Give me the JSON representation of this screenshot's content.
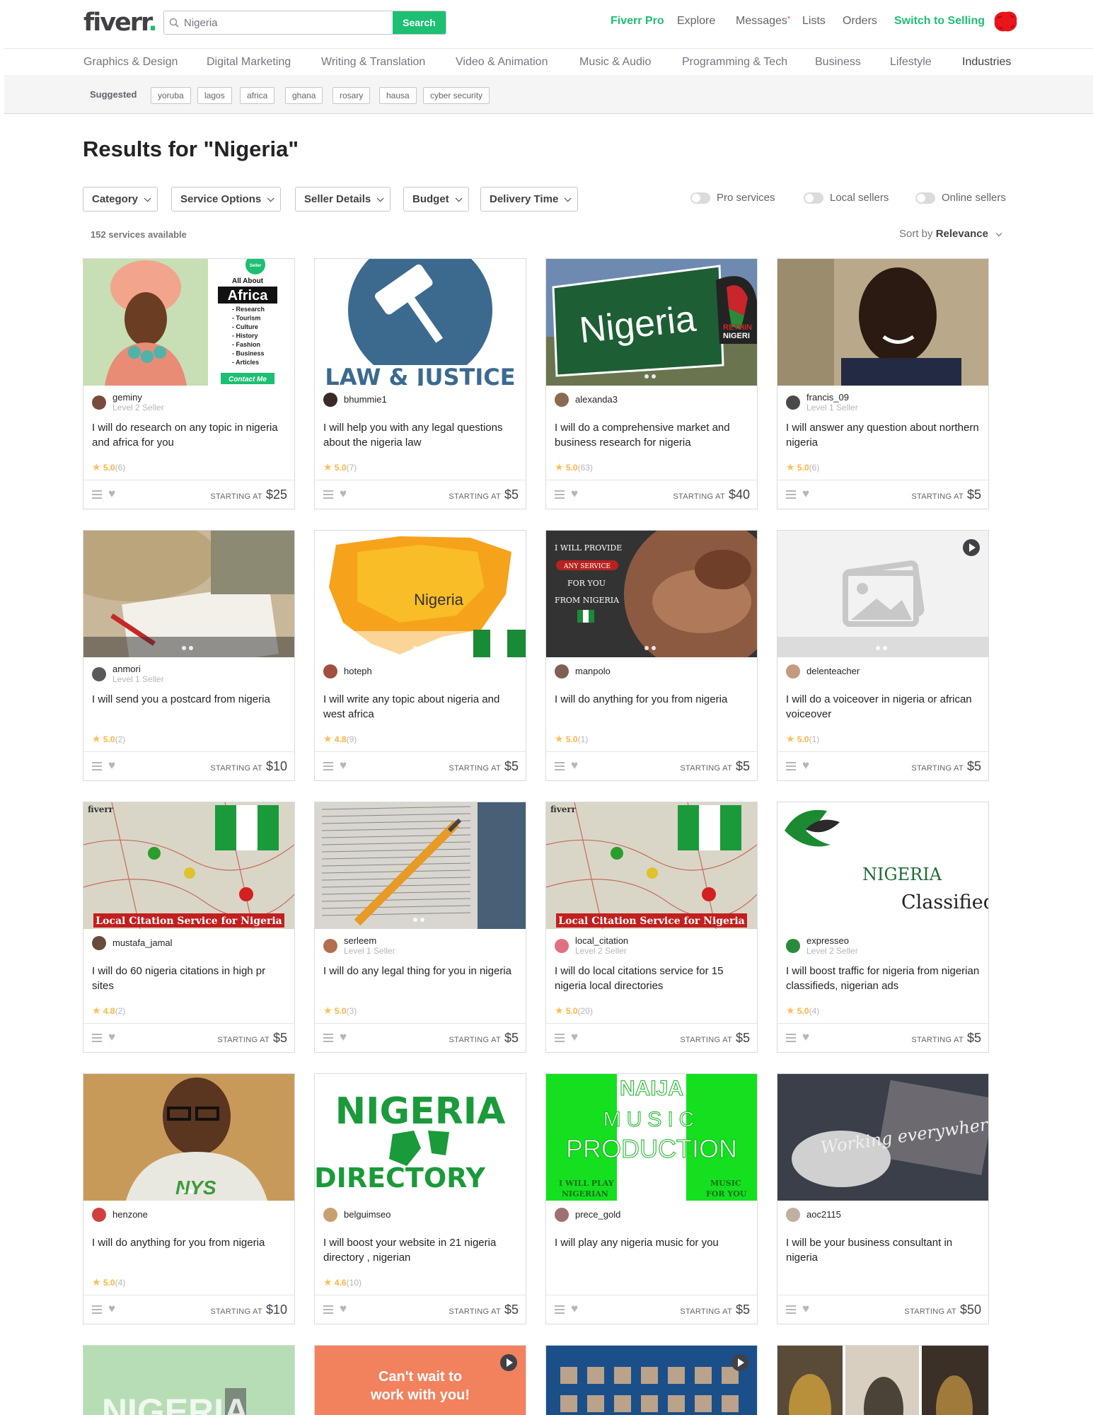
{
  "header": {
    "logo": "fiverr",
    "logo_dot": ".",
    "search_value": "Nigeria",
    "search_button": "Search",
    "nav": {
      "fiverr_pro": "Fiverr Pro",
      "explore": "Explore",
      "messages": "Messages",
      "messages_badge": "*",
      "lists": "Lists",
      "orders": "Orders",
      "switch": "Switch to Selling"
    },
    "accent_color": "#1dbf73"
  },
  "categories": [
    "Graphics & Design",
    "Digital Marketing",
    "Writing & Translation",
    "Video & Animation",
    "Music & Audio",
    "Programming & Tech",
    "Business",
    "Lifestyle",
    "Industries"
  ],
  "suggested": {
    "label": "Suggested",
    "tags": [
      "yoruba",
      "lagos",
      "africa",
      "ghana",
      "rosary",
      "hausa",
      "cyber security"
    ]
  },
  "results_title": "Results for \"Nigeria\"",
  "filters": [
    "Category",
    "Service Options",
    "Seller Details",
    "Budget",
    "Delivery Time"
  ],
  "toggles": [
    "Pro services",
    "Local sellers",
    "Online sellers"
  ],
  "services_count": "152 services available",
  "sort": {
    "prefix": "Sort by",
    "value": "Relevance"
  },
  "price_prefix": "STARTING AT",
  "gigs": [
    {
      "seller": "geminy",
      "level": "Level 2 Seller",
      "desc": "I will do research on any topic in nigeria and africa for you",
      "rating": "5.0",
      "reviews": "(6)",
      "price": "$25",
      "image": "africa-portrait",
      "image_text": {
        "badge": "Seller",
        "heading_small": "All About",
        "heading": "Africa",
        "list": [
          "- Research",
          "- Tourism",
          "- Culture",
          "- History",
          "- Fashion",
          "- Business",
          "- Articles"
        ],
        "button": "Contact Me"
      }
    },
    {
      "seller": "bhummie1",
      "level": "",
      "desc": "I will help you with any legal questions about the nigeria law",
      "rating": "5.0",
      "reviews": "(7)",
      "price": "$5",
      "image": "law-justice",
      "image_text": {
        "caption": "LAW & JUSTICE"
      }
    },
    {
      "seller": "alexanda3",
      "level": "",
      "desc": "I will do a comprehensive market and business research for nigeria",
      "rating": "5.0",
      "reviews": "(63)",
      "price": "$40",
      "image": "nigeria-sign",
      "image_text": {
        "sign": "Nigeria",
        "corner_top": "RETHIN",
        "corner_bottom": "NIGERI"
      }
    },
    {
      "seller": "francis_09",
      "level": "Level 1 Seller",
      "desc": "I will answer any question about northern nigeria",
      "rating": "5.0",
      "reviews": "(6)",
      "price": "$5",
      "image": "selfie"
    },
    {
      "seller": "anmori",
      "level": "Level 1 Seller",
      "desc": "I will send you a postcard from nigeria",
      "rating": "5.0",
      "reviews": "(2)",
      "price": "$10",
      "image": "postcard"
    },
    {
      "seller": "hoteph",
      "level": "",
      "desc": "I will write any topic about nigeria and west africa",
      "rating": "4.8",
      "reviews": "(9)",
      "price": "$5",
      "image": "nigeria-map",
      "image_text": {
        "map_label": "Nigeria"
      }
    },
    {
      "seller": "manpolo",
      "level": "",
      "desc": "I will do anything for you from nigeria",
      "rating": "5.0",
      "reviews": "(1)",
      "price": "$5",
      "image": "baskets",
      "image_text": {
        "line1": "I WILL PROVIDE",
        "line2": "ANY SERVICE",
        "line3": "FOR YOU",
        "line4": "FROM NIGERIA"
      }
    },
    {
      "seller": "delenteacher",
      "level": "",
      "desc": "I will do a voiceover in nigeria or african voiceover",
      "rating": "5.0",
      "reviews": "(1)",
      "price": "$5",
      "image": "placeholder"
    },
    {
      "seller": "mustafa_jamal",
      "level": "",
      "desc": "I will do 60 nigeria citations in high pr sites",
      "rating": "4.8",
      "reviews": "(2)",
      "price": "$5",
      "image": "citation",
      "image_text": {
        "corner": "fiverr",
        "banner": "Local Citation Service for Nigeria"
      }
    },
    {
      "seller": "serleem",
      "level": "Level 1 Seller",
      "desc": "I will do any legal thing for you in nigeria",
      "rating": "5.0",
      "reviews": "(3)",
      "price": "$5",
      "image": "book-pencil"
    },
    {
      "seller": "local_citation",
      "level": "Level 2 Seller",
      "desc": "I will do local citations service for 15 nigeria local directories",
      "rating": "5.0",
      "reviews": "(20)",
      "price": "$5",
      "image": "citation",
      "image_text": {
        "corner": "fiverr",
        "banner": "Local Citation Service for Nigeria"
      }
    },
    {
      "seller": "expresseo",
      "level": "Level 2 Seller",
      "desc": "I will boost traffic for nigeria from nigerian classifieds, nigerian ads",
      "rating": "5.0",
      "reviews": "(4)",
      "price": "$5",
      "image": "classified",
      "image_text": {
        "line1": "NIGERIA",
        "line2": "Classified Ads"
      }
    },
    {
      "seller": "henzone",
      "level": "",
      "desc": "I will do anything for you from nigeria",
      "rating": "5.0",
      "reviews": "(4)",
      "price": "$10",
      "image": "man-glasses",
      "image_text": {
        "shirt": "NYS"
      }
    },
    {
      "seller": "belguimseo",
      "level": "",
      "desc": "I will boost your website in 21 nigeria directory , nigerian",
      "rating": "4.6",
      "reviews": "(10)",
      "price": "$5",
      "image": "directory",
      "image_text": {
        "line1": "NIGERIA",
        "line2": "DIRECTORY"
      }
    },
    {
      "seller": "prece_gold",
      "level": "",
      "desc": "I will play any nigeria music for you",
      "rating": "",
      "reviews": "",
      "price": "$5",
      "image": "naija-music",
      "image_text": {
        "line1": "NAIJA",
        "line2": "MUSIC",
        "line3": "PRODUCTION",
        "left1": "I WILL PLAY",
        "left2": "NIGERIAN",
        "right1": "MUSIC",
        "right2": "FOR YOU"
      }
    },
    {
      "seller": "aoc2115",
      "level": "",
      "desc": "I will be your business consultant in nigeria",
      "rating": "",
      "reviews": "",
      "price": "$50",
      "image": "laptop",
      "image_text": {
        "script": "Working everywhere"
      }
    }
  ],
  "partial_cards": [
    {
      "image": "nigeria-skyline",
      "image_text": {
        "title": "NIGERIA"
      }
    },
    {
      "image": "cant-wait",
      "image_text": {
        "line1": "Can't wait to",
        "line2": "work with you!"
      }
    },
    {
      "image": "faces-collage"
    },
    {
      "image": "artifacts"
    }
  ]
}
